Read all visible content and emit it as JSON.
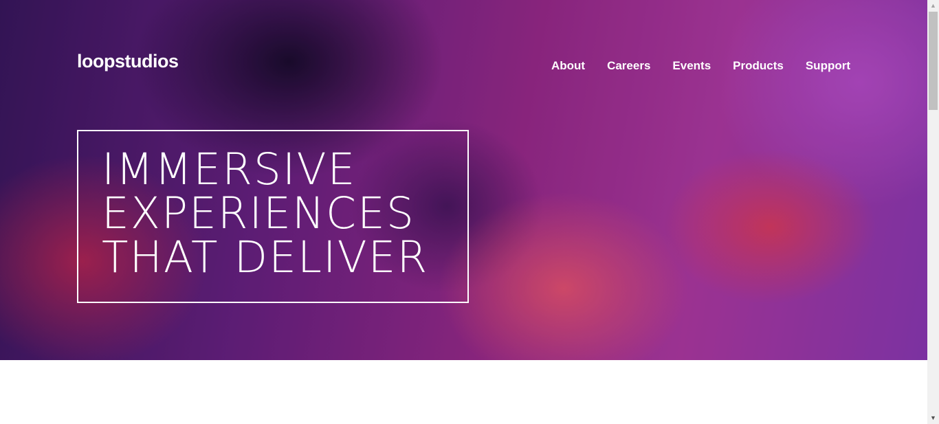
{
  "header": {
    "logo": "loopstudios",
    "nav": [
      "About",
      "Careers",
      "Events",
      "Products",
      "Support"
    ]
  },
  "hero": {
    "headline_lines": [
      "IMMERSIVE",
      "EXPERIENCES",
      "THAT DELIVER"
    ]
  },
  "scrollbar": {
    "up_icon": "▲",
    "down_icon": "▼"
  },
  "colors": {
    "text": "#ffffff",
    "hero_purple": "#9b2a8e",
    "hero_pink": "#e33c5a"
  }
}
